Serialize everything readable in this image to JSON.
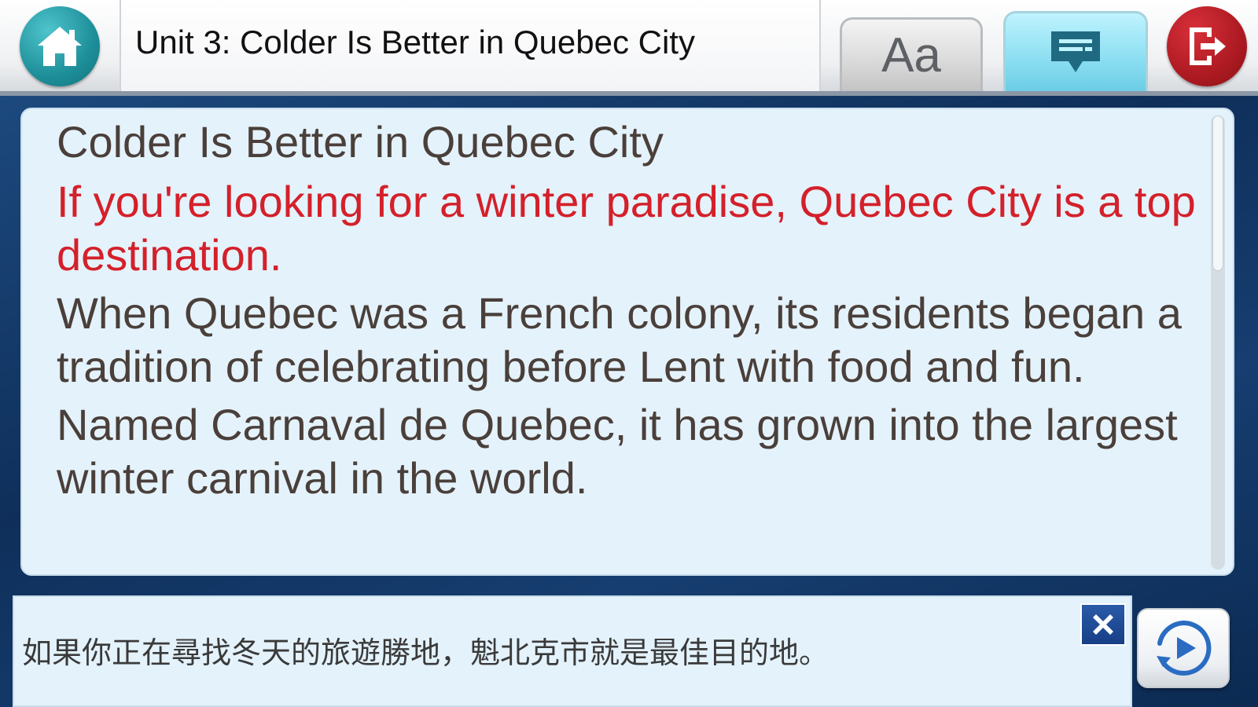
{
  "header": {
    "title": "Unit 3: Colder Is Better in Quebec City",
    "font_button_label": "Aa",
    "icons": {
      "home": "home-icon",
      "subtitle": "subtitle-icon",
      "exit": "exit-icon"
    }
  },
  "reading": {
    "heading": "Colder Is Better in Quebec City",
    "paragraphs": [
      "If you're looking for a winter paradise, Quebec City is a top destination.",
      "When Quebec was a French colony, its residents began a tradition of celebrating before Lent with food and fun.",
      "Named Carnaval de Quebec, it has grown into the largest winter carnival in the world."
    ],
    "active_paragraph_index": 0,
    "highlight_color": "#d4202a",
    "text_color": "#4a3f3a"
  },
  "translation": {
    "text": "如果你正在尋找冬天的旅遊勝地，魁北克市就是最佳目的地。",
    "icons": {
      "close": "close-icon",
      "replay": "replay-icon"
    }
  },
  "colors": {
    "home_button": "#1d8f99",
    "exit_button": "#ad1a22",
    "subtitle_button": "#8fe0f2",
    "panel_background": "#e4f2fb"
  }
}
